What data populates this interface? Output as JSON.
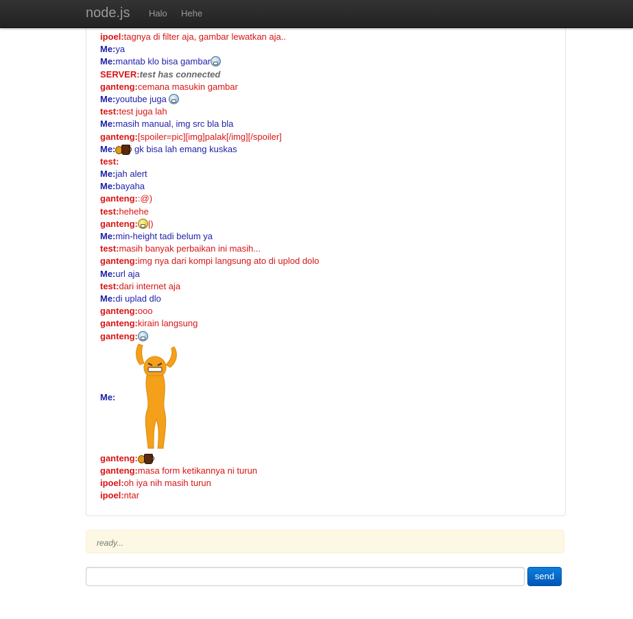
{
  "navbar": {
    "brand": "node.js",
    "links": [
      "Halo",
      "Hehe"
    ]
  },
  "messages": [
    {
      "user": "ipoel:",
      "text": "tagnya di filter aja, gambar lewatkan aja..",
      "side": "them"
    },
    {
      "user": "Me:",
      "text": "ya",
      "side": "me"
    },
    {
      "user": "Me:",
      "text": "mantab klo bisa gambar",
      "side": "me",
      "emoticon": "grin-icon"
    },
    {
      "user": "SERVER:",
      "text": "test has connected",
      "side": "server"
    },
    {
      "user": "ganteng:",
      "text": "cemana masukin gambar",
      "side": "them"
    },
    {
      "user": "Me:",
      "text": "youtube juga ",
      "side": "me",
      "emoticon": "grin-icon"
    },
    {
      "user": "test:",
      "text": "test juga lah",
      "side": "them"
    },
    {
      "user": "Me:",
      "text": "masih manual, img src bla bla",
      "side": "me"
    },
    {
      "user": "ganteng:",
      "text": "[spoiler=pic][img]palak[/img][/spoiler]",
      "side": "them"
    },
    {
      "user": "Me:",
      "text": " gk bisa lah emang kuskas",
      "side": "me",
      "emoticon_before": "coffee-icon"
    },
    {
      "user": "test:",
      "text": "",
      "side": "them"
    },
    {
      "user": "Me:",
      "text": "jah alert",
      "side": "me"
    },
    {
      "user": "Me:",
      "text": "bayaha",
      "side": "me"
    },
    {
      "user": "ganteng:",
      "text": ":@)",
      "side": "them"
    },
    {
      "user": "test:",
      "text": "hehehe",
      "side": "them"
    },
    {
      "user": "ganteng:",
      "text": "|)",
      "side": "them",
      "emoticon_before": "smile-icon"
    },
    {
      "user": "Me:",
      "text": "min-height tadi belum ya",
      "side": "me"
    },
    {
      "user": "test:",
      "text": "masih banyak perbaikan ini masih...",
      "side": "them"
    },
    {
      "user": "ganteng:",
      "text": "img nya dari kompi langsung ato di uplod dolo",
      "side": "them"
    },
    {
      "user": "Me:",
      "text": "url aja",
      "side": "me"
    },
    {
      "user": "test:",
      "text": "dari internet aja",
      "side": "them"
    },
    {
      "user": "Me:",
      "text": "di uplad dlo",
      "side": "me"
    },
    {
      "user": "ganteng:",
      "text": "ooo",
      "side": "them"
    },
    {
      "user": "ganteng:",
      "text": "kirain langsung",
      "side": "them"
    },
    {
      "user": "ganteng:",
      "text": "",
      "side": "them",
      "emoticon": "grin-icon"
    },
    {
      "user": "Me:",
      "text": "",
      "side": "me",
      "image": "dancing-figure-image"
    },
    {
      "user": "ganteng:",
      "text": "",
      "side": "them",
      "emoticon": "coffee-icon"
    },
    {
      "user": "ganteng:",
      "text": "masa form ketikannya ni turun",
      "side": "them"
    },
    {
      "user": "ipoel:",
      "text": "oh iya nih masih turun",
      "side": "them"
    },
    {
      "user": "ipoel:",
      "text": "ntar",
      "side": "them"
    }
  ],
  "status": {
    "text": "ready..."
  },
  "composer": {
    "value": "",
    "send_label": "send"
  },
  "colors": {
    "them": "#d81414",
    "me": "#1d1fa8",
    "server_text": "#666666",
    "alert_bg": "#fcf8e3",
    "button": "#0066cc"
  }
}
